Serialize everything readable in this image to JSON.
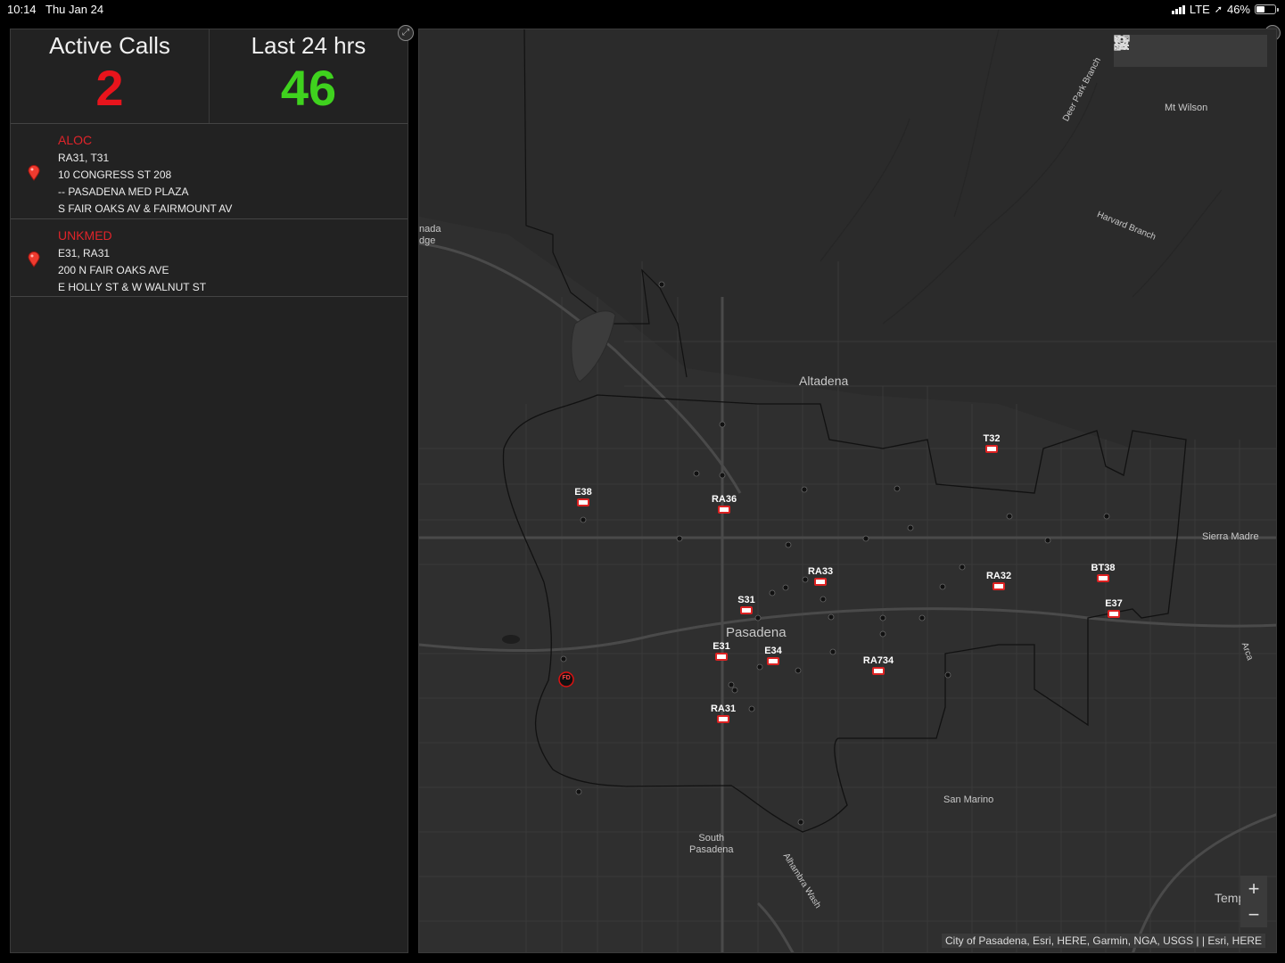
{
  "status": {
    "time": "10:14",
    "date": "Thu Jan 24",
    "network": "LTE",
    "battery": "46%"
  },
  "counters": {
    "active_label": "Active Calls",
    "active_value": "2",
    "active_color": "#e8141c",
    "last_label": "Last 24 hrs",
    "last_value": "46",
    "last_color": "#3fd21e"
  },
  "calls": [
    {
      "type": "ALOC",
      "units": "RA31, T31",
      "address": "10  CONGRESS ST 208",
      "place": "-- PASADENA MED PLAZA",
      "cross": "S FAIR OAKS AV  &  FAIRMOUNT AV"
    },
    {
      "type": "UNKMED",
      "units": "E31, RA31",
      "address": "200 N FAIR OAKS AVE",
      "cross": "E HOLLY ST  &  W WALNUT ST"
    }
  ],
  "map": {
    "places": {
      "altadena": "Altadena",
      "pasadena": "Pasadena",
      "mt_wilson": "Mt Wilson",
      "sierra_madre": "Sierra Madre",
      "san_marino": "San Marino",
      "south_pasadena_1": "South",
      "south_pasadena_2": "Pasadena",
      "la_canada_1": "nada",
      "la_canada_2": "dge",
      "deer_park": "Deer Park Branch",
      "harvard": "Harvard Branch",
      "alhambra_wash": "Alhambra Wash",
      "arcadia": "Arca",
      "temple": "Templ"
    },
    "units": {
      "e38": "E38",
      "ra36": "RA36",
      "t32": "T32",
      "ra33": "RA33",
      "ra32": "RA32",
      "bt38": "BT38",
      "s31": "S31",
      "e37": "E37",
      "e31": "E31",
      "e34": "E34",
      "ra734": "RA734",
      "ra31": "RA31",
      "fd": "FD"
    },
    "tools": [
      "search-icon",
      "home-icon",
      "list-icon",
      "layers-icon",
      "qr-icon"
    ],
    "zoom_in": "+",
    "zoom_out": "−",
    "attribution": "City of Pasadena, Esri, HERE, Garmin, NGA, USGS | | Esri, HERE"
  }
}
